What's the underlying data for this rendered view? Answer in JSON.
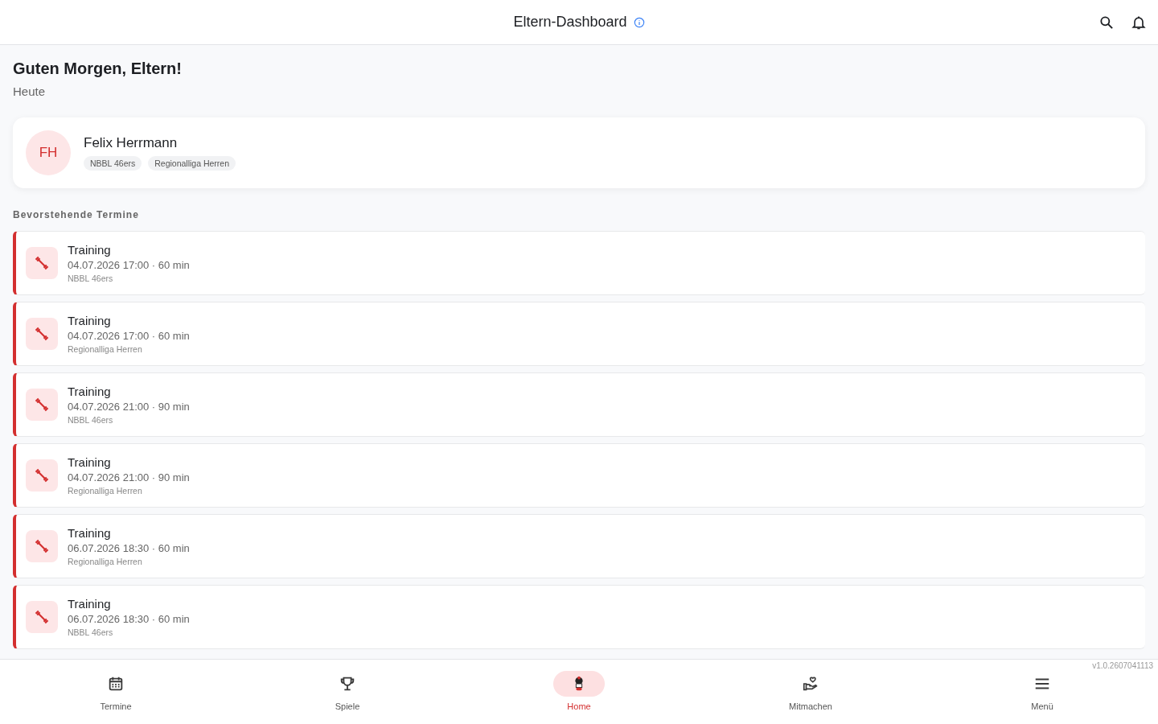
{
  "header": {
    "title": "Eltern-Dashboard"
  },
  "greeting": {
    "title": "Guten Morgen, Eltern!",
    "subtitle": "Heute"
  },
  "profile": {
    "initials": "FH",
    "name": "Felix Herrmann",
    "teams": [
      "NBBL 46ers",
      "Regionalliga Herren"
    ]
  },
  "section_title": "Bevorstehende Termine",
  "events": [
    {
      "title": "Training",
      "when": "04.07.2026 17:00 · 60 min",
      "team": "NBBL 46ers"
    },
    {
      "title": "Training",
      "when": "04.07.2026 17:00 · 60 min",
      "team": "Regionalliga Herren"
    },
    {
      "title": "Training",
      "when": "04.07.2026 21:00 · 90 min",
      "team": "NBBL 46ers"
    },
    {
      "title": "Training",
      "when": "04.07.2026 21:00 · 90 min",
      "team": "Regionalliga Herren"
    },
    {
      "title": "Training",
      "when": "06.07.2026 18:30 · 60 min",
      "team": "Regionalliga Herren"
    },
    {
      "title": "Training",
      "when": "06.07.2026 18:30 · 60 min",
      "team": "NBBL 46ers"
    }
  ],
  "version": "v1.0.2607041113",
  "nav": [
    {
      "label": "Termine",
      "selected": false
    },
    {
      "label": "Spiele",
      "selected": false
    },
    {
      "label": "Home",
      "selected": true
    },
    {
      "label": "Mitmachen",
      "selected": false
    },
    {
      "label": "Menü",
      "selected": false
    }
  ]
}
